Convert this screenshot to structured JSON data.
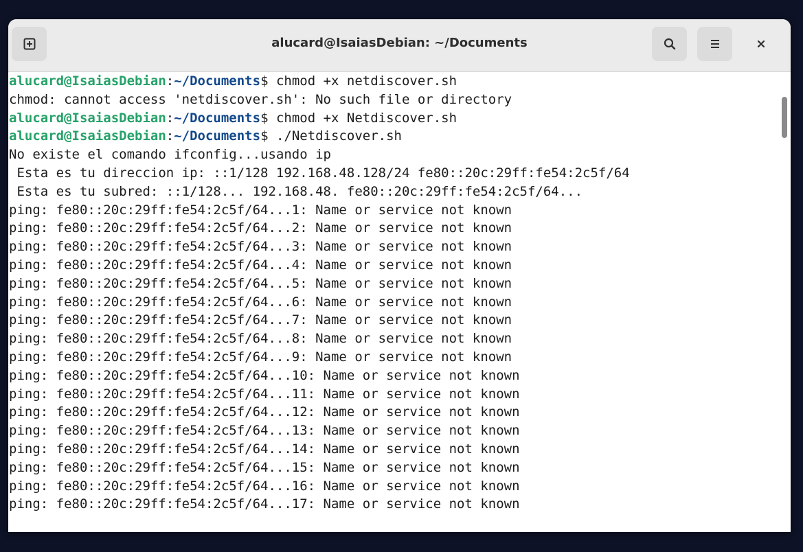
{
  "window": {
    "title": "alucard@IsaiasDebian: ~/Documents"
  },
  "icons": {
    "new_tab": "new-tab-icon",
    "search": "search-icon",
    "menu": "hamburger-menu-icon",
    "close": "close-icon"
  },
  "colors": {
    "prompt_user": "#26a269",
    "prompt_path": "#12488b",
    "text": "#1d1d1d",
    "titlebar": "#ebebeb",
    "desktop": "#0d1226"
  },
  "prompt": {
    "user_host": "alucard@IsaiasDebian",
    "separator": ":",
    "path": "~/Documents",
    "symbol": "$ "
  },
  "lines": [
    {
      "type": "prompt",
      "command": "chmod +x netdiscover.sh"
    },
    {
      "type": "output",
      "text": "chmod: cannot access 'netdiscover.sh': No such file or directory"
    },
    {
      "type": "prompt",
      "command": "chmod +x Netdiscover.sh"
    },
    {
      "type": "prompt",
      "command": "./Netdiscover.sh"
    },
    {
      "type": "output",
      "text": "No existe el comando ifconfig...usando ip"
    },
    {
      "type": "output",
      "text": " Esta es tu direccion ip: ::1/128 192.168.48.128/24 fe80::20c:29ff:fe54:2c5f/64"
    },
    {
      "type": "output",
      "text": " Esta es tu subred: ::1/128... 192.168.48. fe80::20c:29ff:fe54:2c5f/64..."
    },
    {
      "type": "output",
      "text": "ping: fe80::20c:29ff:fe54:2c5f/64...1: Name or service not known"
    },
    {
      "type": "output",
      "text": "ping: fe80::20c:29ff:fe54:2c5f/64...2: Name or service not known"
    },
    {
      "type": "output",
      "text": "ping: fe80::20c:29ff:fe54:2c5f/64...3: Name or service not known"
    },
    {
      "type": "output",
      "text": "ping: fe80::20c:29ff:fe54:2c5f/64...4: Name or service not known"
    },
    {
      "type": "output",
      "text": "ping: fe80::20c:29ff:fe54:2c5f/64...5: Name or service not known"
    },
    {
      "type": "output",
      "text": "ping: fe80::20c:29ff:fe54:2c5f/64...6: Name or service not known"
    },
    {
      "type": "output",
      "text": "ping: fe80::20c:29ff:fe54:2c5f/64...7: Name or service not known"
    },
    {
      "type": "output",
      "text": "ping: fe80::20c:29ff:fe54:2c5f/64...8: Name or service not known"
    },
    {
      "type": "output",
      "text": "ping: fe80::20c:29ff:fe54:2c5f/64...9: Name or service not known"
    },
    {
      "type": "output",
      "text": "ping: fe80::20c:29ff:fe54:2c5f/64...10: Name or service not known"
    },
    {
      "type": "output",
      "text": "ping: fe80::20c:29ff:fe54:2c5f/64...11: Name or service not known"
    },
    {
      "type": "output",
      "text": "ping: fe80::20c:29ff:fe54:2c5f/64...12: Name or service not known"
    },
    {
      "type": "output",
      "text": "ping: fe80::20c:29ff:fe54:2c5f/64...13: Name or service not known"
    },
    {
      "type": "output",
      "text": "ping: fe80::20c:29ff:fe54:2c5f/64...14: Name or service not known"
    },
    {
      "type": "output",
      "text": "ping: fe80::20c:29ff:fe54:2c5f/64...15: Name or service not known"
    },
    {
      "type": "output",
      "text": "ping: fe80::20c:29ff:fe54:2c5f/64...16: Name or service not known"
    },
    {
      "type": "output",
      "text": "ping: fe80::20c:29ff:fe54:2c5f/64...17: Name or service not known"
    }
  ]
}
